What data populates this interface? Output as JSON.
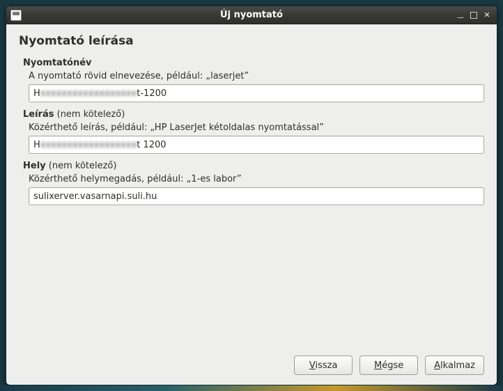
{
  "window": {
    "title": "Új nyomtató"
  },
  "page": {
    "heading": "Nyomtató leírása"
  },
  "sections": {
    "name": {
      "label": "Nyomtatónév",
      "hint": "A nyomtató rövid elnevezése, például: „laserjet”",
      "value_prefix": "H",
      "value_blurred": "xxxxxxxxxxxxxxxxxx",
      "value_suffix": "t-1200"
    },
    "description": {
      "label": "Leírás",
      "optional": " (nem kötelező)",
      "hint": "Közérthető leírás, például: „HP LaserJet kétoldalas nyomtatással”",
      "value_prefix": "H",
      "value_blurred": "xxxxxxxxxxxxxxxxxx",
      "value_suffix": "t 1200"
    },
    "location": {
      "label": "Hely",
      "optional": " (nem kötelező)",
      "hint": "Közérthető helymegadás, például: „1-es labor”",
      "value": "sulixerver.vasarnapi.suli.hu"
    }
  },
  "buttons": {
    "back_mn": "V",
    "back_rest": "issza",
    "cancel_mn": "M",
    "cancel_rest": "égse",
    "apply_mn": "A",
    "apply_rest": "lkalmaz"
  }
}
